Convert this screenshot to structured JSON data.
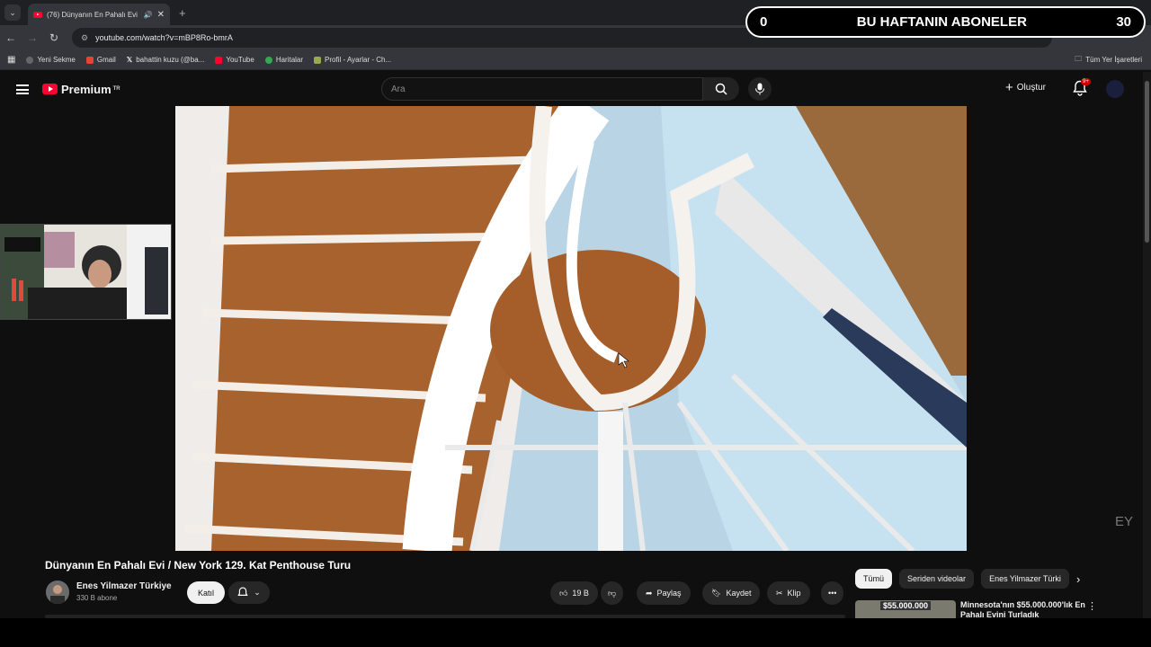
{
  "browser": {
    "tab_title": "(76) Dünyanın En Pahalı Evi",
    "url": "youtube.com/watch?v=mBP8Ro-bmrA",
    "bookmarks": [
      "Yeni Sekme",
      "Gmail",
      "bahattin kuzu (@ba...",
      "YouTube",
      "Haritalar",
      "Profil - Ayarlar - Ch..."
    ],
    "all_bookmarks": "Tüm Yer İşaretleri"
  },
  "youtube": {
    "logo": "Premium",
    "logo_region": "TR",
    "search_placeholder": "Ara",
    "create_label": "Oluştur",
    "notif_count": "9+"
  },
  "overlay": {
    "left_count": "0",
    "text": "BU HAFTANIN ABONELER",
    "right_count": "30"
  },
  "watermark": "EY",
  "video_info": {
    "title": "Dünyanın En Pahalı Evi / New York 129. Kat Penthouse Turu",
    "channel": "Enes Yilmazer Türkiye",
    "subs": "330 B abone",
    "join": "Katıl",
    "likes": "19 B",
    "share": "Paylaş",
    "save": "Kaydet",
    "clip": "Klip"
  },
  "chips": [
    "Tümü",
    "Seriden videolar",
    "Enes Yilmazer Türki"
  ],
  "recommendation": {
    "thumb_text": "$55.000.000",
    "title": "Minnesota'nın $55.000.000'lık En Pahalı Evini Turladık"
  }
}
